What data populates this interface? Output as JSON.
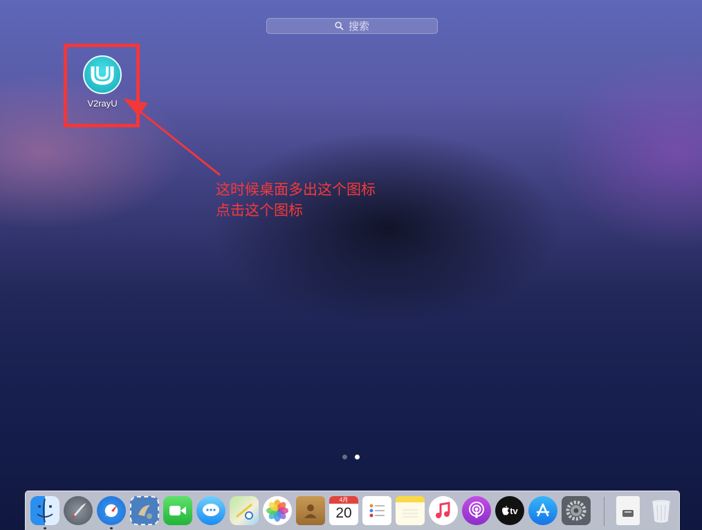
{
  "search": {
    "placeholder": "搜索",
    "icon": "search-icon"
  },
  "launchpad_app": {
    "label": "V2rayU",
    "icon": "v2rayu-logo-icon",
    "logo_color": "#1fb7c5"
  },
  "annotation": {
    "line1": "这时候桌面多出这个图标",
    "line2": "点击这个图标",
    "color": "#f53a3a"
  },
  "page_indicator": {
    "pages": 2,
    "current": 2
  },
  "calendar": {
    "month": "4月",
    "day": "20"
  },
  "appletv": {
    "label": "tv"
  },
  "dock_items": [
    "finder",
    "launchpad",
    "safari",
    "mail",
    "facetime",
    "messages",
    "maps",
    "photos",
    "contacts",
    "calendar",
    "reminders",
    "notes",
    "music",
    "podcasts",
    "apple-tv",
    "app-store",
    "system-preferences",
    "downloads",
    "trash"
  ]
}
